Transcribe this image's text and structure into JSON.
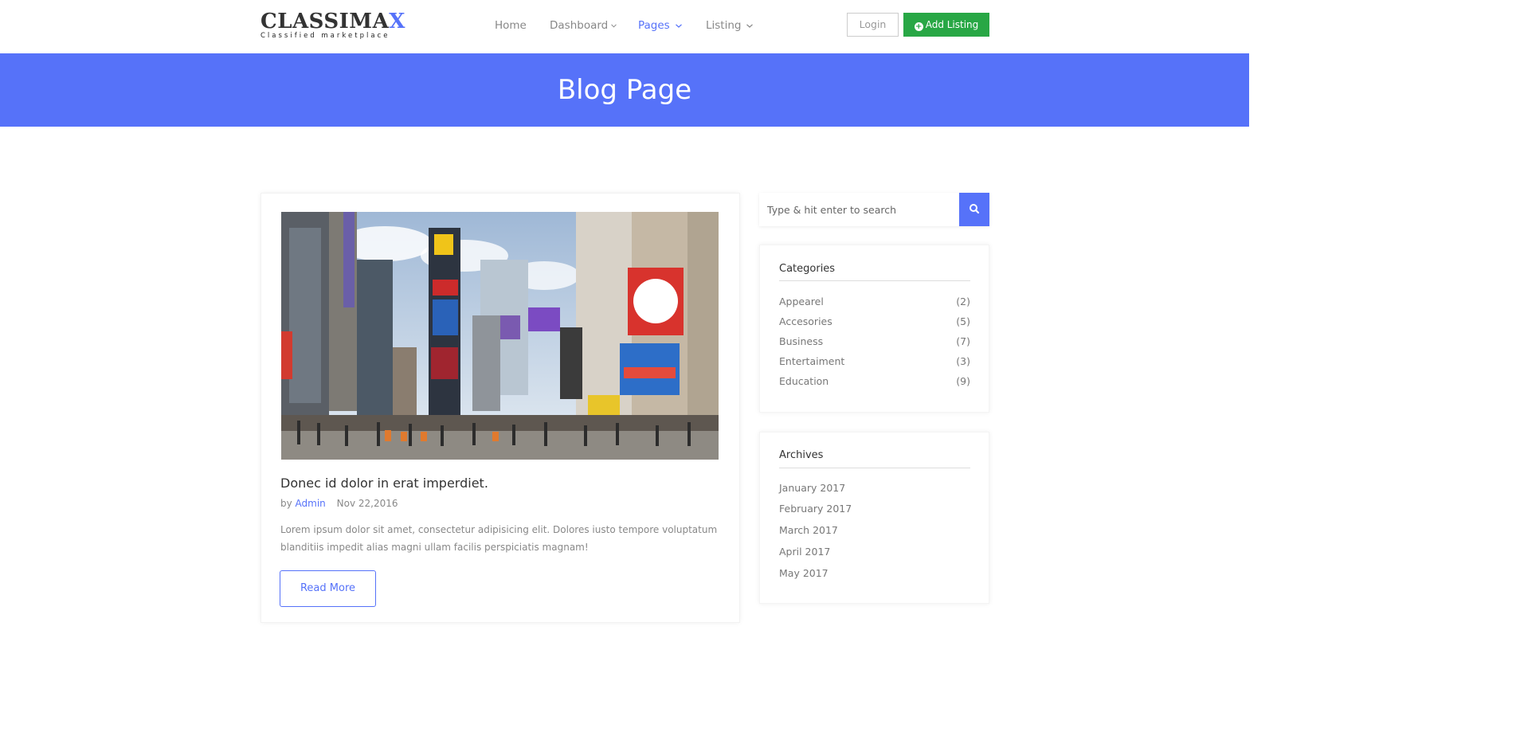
{
  "header": {
    "logo_main": "CLASSIMA",
    "logo_accent": "X",
    "logo_tagline": "Classified marketplace",
    "nav": [
      {
        "label": "Home",
        "has_dropdown": false,
        "active": false
      },
      {
        "label": "Dashboard",
        "has_dropdown": true,
        "active": false
      },
      {
        "label": "Pages",
        "has_dropdown": true,
        "active": true
      },
      {
        "label": "Listing",
        "has_dropdown": true,
        "active": false
      }
    ],
    "login_label": "Login",
    "add_listing_label": "Add Listing",
    "add_listing_icon": "plus-circle-icon"
  },
  "banner": {
    "title": "Blog Page"
  },
  "post": {
    "title": "Donec id dolor in erat imperdiet.",
    "by_label": "by",
    "author": "Admin",
    "date": "Nov 22,2016",
    "excerpt": "Lorem ipsum dolor sit amet, consectetur adipisicing elit. Dolores iusto tempore voluptatum blanditiis impedit alias magni ullam facilis perspiciatis magnam!",
    "read_more_label": "Read More"
  },
  "sidebar": {
    "search_placeholder": "Type & hit enter to search",
    "search_icon": "search-icon",
    "categories_title": "Categories",
    "categories": [
      {
        "name": "Appearel",
        "count": "(2)"
      },
      {
        "name": "Accesories",
        "count": "(5)"
      },
      {
        "name": "Business",
        "count": "(7)"
      },
      {
        "name": "Entertaiment",
        "count": "(3)"
      },
      {
        "name": "Education",
        "count": "(9)"
      }
    ],
    "archives_title": "Archives",
    "archives": [
      "January 2017",
      "February 2017",
      "March 2017",
      "April 2017",
      "May 2017"
    ]
  },
  "colors": {
    "accent": "#5672f9",
    "success": "#28a745",
    "text": "#333333",
    "muted": "#888888"
  }
}
